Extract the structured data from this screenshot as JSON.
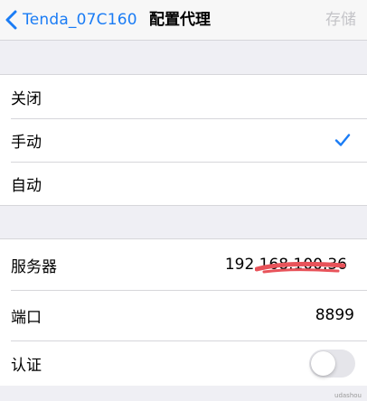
{
  "nav": {
    "back_label": "Tenda_07C160",
    "title": "配置代理",
    "save_label": "存储",
    "back_icon": "chevron-left-icon"
  },
  "proxy_modes": [
    {
      "label": "关闭",
      "selected": false
    },
    {
      "label": "手动",
      "selected": true
    },
    {
      "label": "自动",
      "selected": false
    }
  ],
  "server": {
    "label": "服务器",
    "value": "192.168.100.36"
  },
  "port": {
    "label": "端口",
    "value": "8899"
  },
  "auth": {
    "label": "认证",
    "enabled": false
  },
  "watermark": "udashou",
  "colors": {
    "accent": "#1a7cf5",
    "disabled": "#c4c4c8",
    "redaction": "#e8535a"
  }
}
